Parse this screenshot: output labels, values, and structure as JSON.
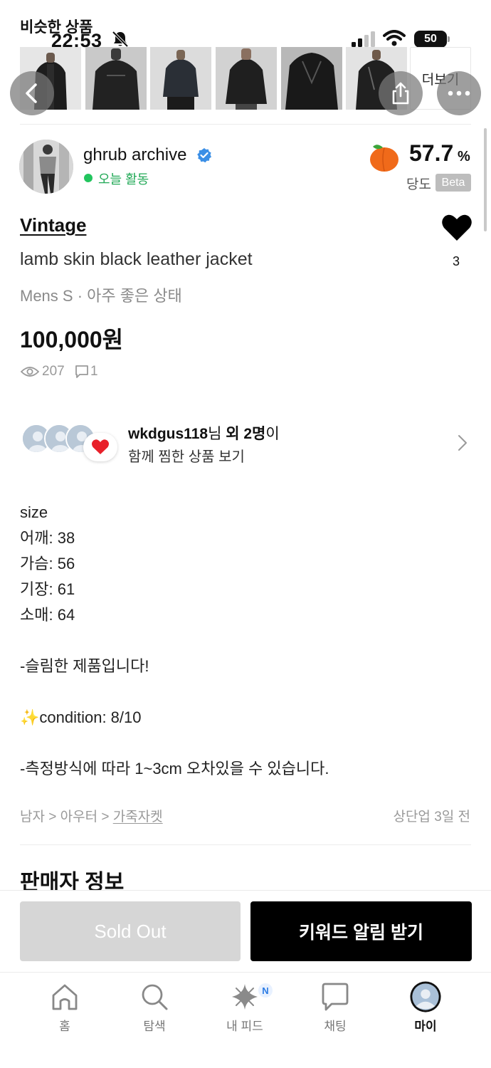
{
  "status_bar": {
    "time": "22:53",
    "battery": "50"
  },
  "similar": {
    "title": "비슷한 상품",
    "more_label": "더보기"
  },
  "seller": {
    "name": "ghrub archive",
    "activity": "오늘 활동",
    "score_value": "57.7",
    "score_unit": "%",
    "score_label": "당도",
    "score_badge": "Beta"
  },
  "product": {
    "brand": "Vintage",
    "title": "lamb skin black leather jacket",
    "meta": "Mens S · 아주 좋은 상태",
    "price": "100,000원",
    "likes": "3",
    "views": "207",
    "comments": "1"
  },
  "wish_together": {
    "user": "wkdgus118",
    "suffix_1": "님 ",
    "others": "외 2명",
    "suffix_2": "이",
    "line2": "함께 찜한 상품 보기"
  },
  "description": "size\n어깨: 38\n가슴: 56\n기장: 61\n소매: 64\n\n-슬림한 제품입니다!\n\n✨condition: 8/10\n\n-측정방식에 따라 1~3cm 오차있을 수 있습니다.",
  "category": {
    "path_prefix": "남자 > 아우터 > ",
    "leaf": "가죽자켓",
    "bump_time": "상단업 3일 전"
  },
  "seller_info_title": "판매자 정보",
  "actions": {
    "sold_out": "Sold Out",
    "keyword_alert": "키워드 알림 받기"
  },
  "tabs": [
    {
      "label": "홈",
      "icon": "home-icon"
    },
    {
      "label": "탐색",
      "icon": "search-icon"
    },
    {
      "label": "내 피드",
      "icon": "sparkle-icon",
      "badge": "N"
    },
    {
      "label": "채팅",
      "icon": "chat-icon"
    },
    {
      "label": "마이",
      "icon": "profile-icon",
      "active": true
    }
  ],
  "colors": {
    "accent_green": "#22a957",
    "verified_blue": "#3b8fe6",
    "peach": "#f06a1a",
    "sold_out_gray": "#d6d6d6",
    "primary_black": "#000000"
  }
}
